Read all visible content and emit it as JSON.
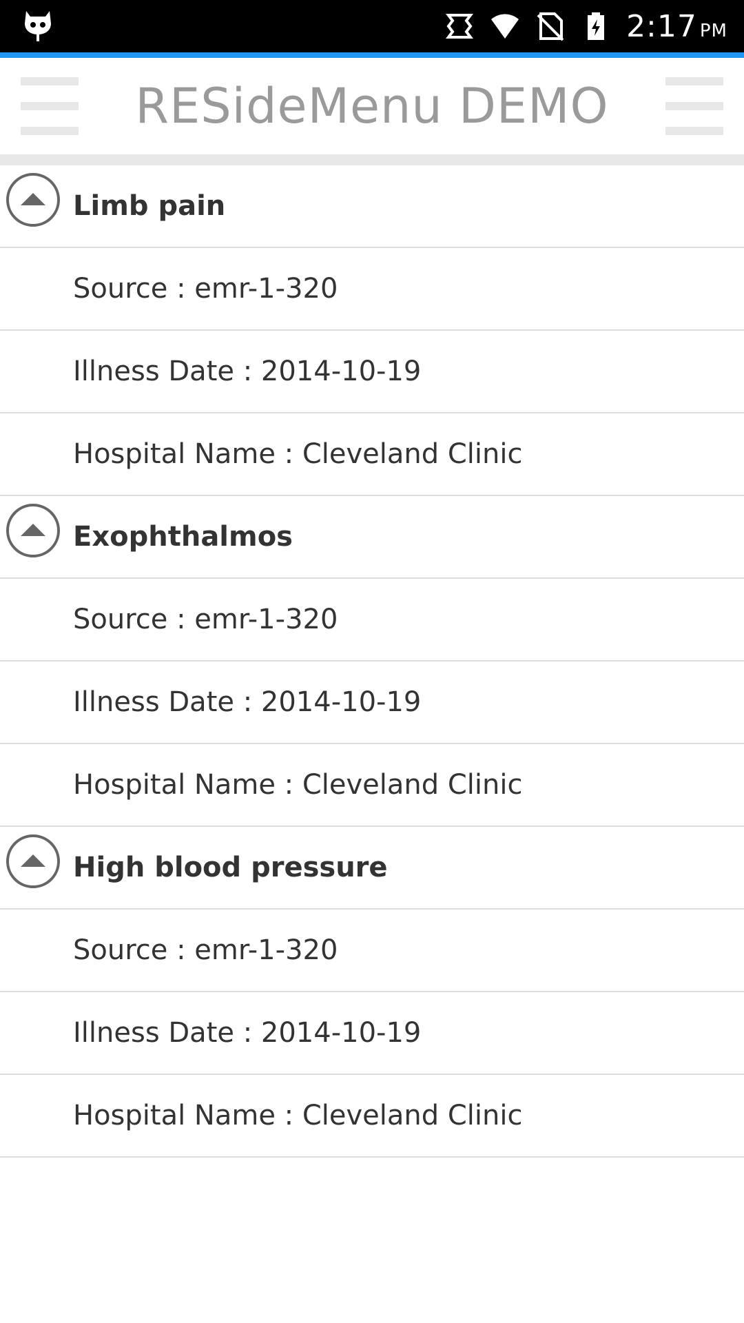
{
  "status_bar": {
    "time": "2:17",
    "ampm": "PM",
    "icons": [
      "cyanogen-cat-icon",
      "sync-icon",
      "wifi-icon",
      "no-sim-icon",
      "battery-charging-icon"
    ]
  },
  "header": {
    "title": "RESideMenu DEMO",
    "left_menu_icon": "hamburger-icon",
    "right_menu_icon": "hamburger-icon"
  },
  "colors": {
    "accent": "#2196f3",
    "title": "#9a9a9a",
    "text": "#333333",
    "divider": "#dcdcdc"
  },
  "groups": [
    {
      "title": "Limb pain",
      "expanded": true,
      "children": [
        "Source : emr-1-320",
        "Illness Date : 2014-10-19",
        "Hospital Name : Cleveland Clinic"
      ]
    },
    {
      "title": "Exophthalmos",
      "expanded": true,
      "children": [
        "Source : emr-1-320",
        "Illness Date : 2014-10-19",
        "Hospital Name : Cleveland Clinic"
      ]
    },
    {
      "title": "High blood pressure",
      "expanded": true,
      "children": [
        "Source : emr-1-320",
        "Illness Date : 2014-10-19",
        "Hospital Name : Cleveland Clinic"
      ]
    }
  ]
}
